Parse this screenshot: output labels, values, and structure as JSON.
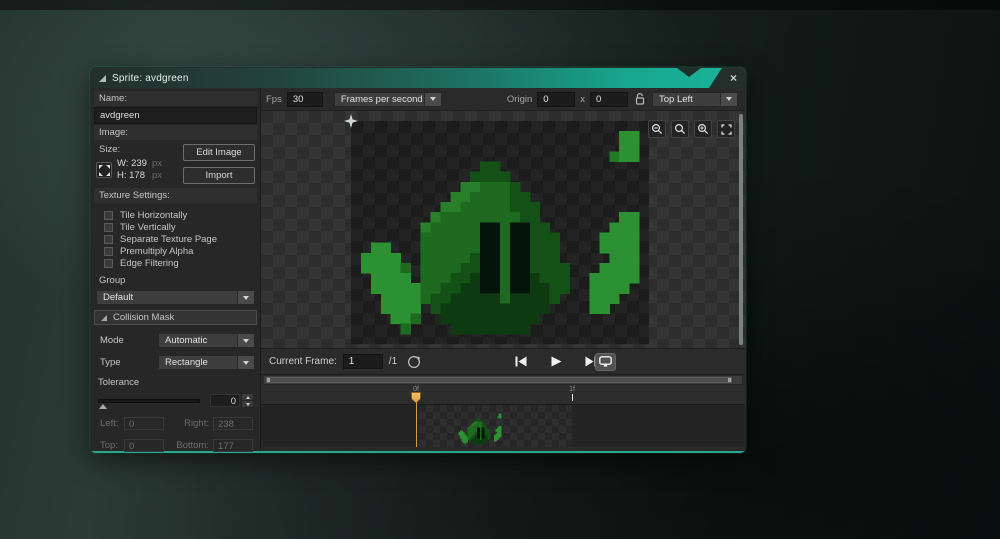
{
  "window": {
    "title": "Sprite: avdgreen",
    "close_label": "×"
  },
  "left_panel": {
    "name_label": "Name:",
    "name_value": "avdgreen",
    "image_label": "Image:",
    "size": {
      "label": "Size:",
      "width_text": "W: 239",
      "height_text": "H: 178",
      "px": "px"
    },
    "edit_image_button": "Edit Image",
    "import_button": "Import",
    "texture_settings_label": "Texture Settings:",
    "checkboxes": [
      {
        "label": "Tile Horizontally",
        "checked": false
      },
      {
        "label": "Tile Vertically",
        "checked": false
      },
      {
        "label": "Separate Texture Page",
        "checked": false
      },
      {
        "label": "Premultiply Alpha",
        "checked": false
      },
      {
        "label": "Edge Filtering",
        "checked": false
      }
    ],
    "group_label": "Group",
    "group_value": "Default",
    "collision_mask": {
      "header": "Collision Mask",
      "mode_label": "Mode",
      "mode_value": "Automatic",
      "type_label": "Type",
      "type_value": "Rectangle",
      "tolerance_label": "Tolerance",
      "tolerance_value": "0",
      "left_label": "Left:",
      "left_value": "0",
      "right_label": "Right:",
      "right_value": "238",
      "top_label": "Top:",
      "top_value": "0",
      "bottom_label": "Bottom:",
      "bottom_value": "177"
    }
  },
  "toolbar": {
    "fps_label": "Fps",
    "fps_value": "30",
    "speed_mode": "Frames per second",
    "origin_label": "Origin",
    "origin_x": "0",
    "origin_separator": "x",
    "origin_y": "0",
    "origin_preset": "Top Left"
  },
  "playback": {
    "current_frame_label": "Current Frame:",
    "current_frame_value": "1",
    "frame_count": "/1"
  },
  "timeline": {
    "frame_labels": [
      "0f",
      "1f"
    ]
  },
  "colors": {
    "accent_teal": "#17a68e",
    "playhead_orange": "#d89b3c"
  },
  "sprite": {
    "palette": {
      "g": "#1d6a20",
      "h": "#2a7f2c",
      "d": "#145117",
      "D": "#0d3a11",
      "k": "#04140a",
      "G": "#2c9132",
      "m": "#1f7a23"
    },
    "pixel_map": [
      "..............................",
      "...........................GG.",
      "...........................GG.",
      "..........................mGG.",
      ".............dd...............",
      "............dddd..............",
      "...........hhgggd.............",
      "..........hhggggdd............",
      ".........hhgggggddd...........",
      "........hggggggggdd........GG.",
      ".......hgggggkkgkkdd......GGG.",
      ".......ggggggkkgkkddd....GGGG.",
      "..GG...ggggggkkgkkddd....GGGG.",
      ".GGGG..gggggdkkgkkddd.....GGG.",
      ".GGGGg.ggggddkkgkkdddd...GGGG.",
      "..GGGG.gggddDkkgkkDddd..GGGGG.",
      "..GGGGGggddDDkkgkkDDdd..GGGG..",
      "...GGGGgddDDDDDgDDDDd...GGG...",
      "...GGGG.dDDDDDDDDDDD....GG....",
      "....GGg..DDDDDDDDDD...........",
      ".....g....DDDDDDDD............",
      ".............................."
    ]
  }
}
